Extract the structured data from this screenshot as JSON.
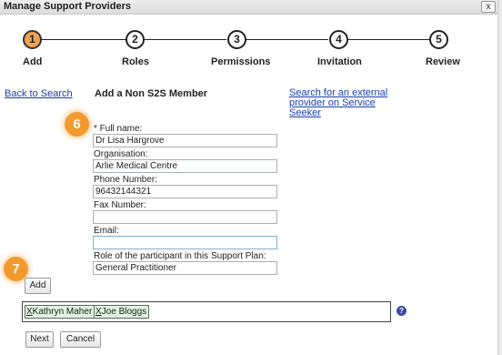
{
  "window": {
    "title": "Manage Support Providers",
    "close_glyph": "x"
  },
  "steps": [
    {
      "number": "1",
      "label": "Add",
      "active": true
    },
    {
      "number": "2",
      "label": "Roles"
    },
    {
      "number": "3",
      "label": "Permissions"
    },
    {
      "number": "4",
      "label": "Invitation"
    },
    {
      "number": "5",
      "label": "Review"
    }
  ],
  "nav": {
    "back_link": "Back to Search",
    "section_title": "Add a Non S2S Member",
    "external_link": "Search for an external provider on Service Seeker"
  },
  "callouts": {
    "form": "6",
    "add": "7"
  },
  "form": {
    "full_name": {
      "label": "* Full name:",
      "value": "Dr Lisa Hargrove"
    },
    "organisation": {
      "label": "Organisation:",
      "value": "Arlie Medical Centre"
    },
    "phone": {
      "label": "Phone Number:",
      "value": "96432144321"
    },
    "fax": {
      "label": "Fax Number:",
      "value": ""
    },
    "email": {
      "label": "Email:",
      "value": ""
    },
    "role": {
      "label": "Role of the participant in this Support Plan:",
      "value": "General Practitioner"
    }
  },
  "buttons": {
    "add": "Add",
    "next": "Next",
    "cancel": "Cancel"
  },
  "members": [
    {
      "remove": "X",
      "name": "Kathryn Maher"
    },
    {
      "remove": "X",
      "name": "Joe Bloggs"
    }
  ],
  "help_icon": {
    "name": "help-icon",
    "glyph": "?"
  },
  "colors": {
    "active_step": "#f0a253",
    "callout": "#f29a2e",
    "chip_bg": "#def4de",
    "link": "#1a3fb0"
  }
}
